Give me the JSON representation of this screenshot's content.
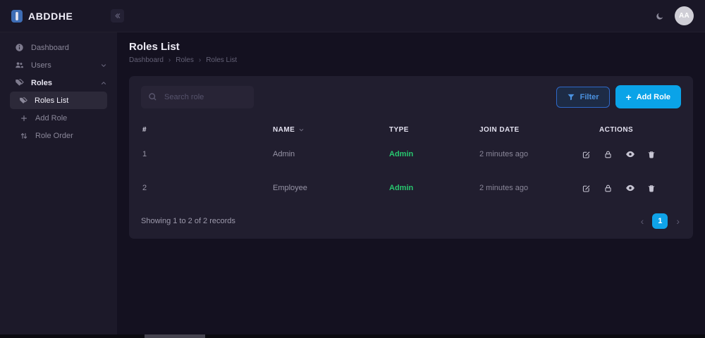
{
  "topbar": {
    "brand": "ABDDHE",
    "avatar_initials": "AA"
  },
  "sidebar": {
    "items": [
      {
        "label": "Dashboard",
        "icon": "dashboard-icon"
      },
      {
        "label": "Users",
        "icon": "users-icon"
      },
      {
        "label": "Roles",
        "icon": "roles-icon"
      },
      {
        "label": "Roles List",
        "icon": "roles-list-icon",
        "active": true
      },
      {
        "label": "Add Role",
        "icon": "plus-icon"
      },
      {
        "label": "Role Order",
        "icon": "sort-order-icon"
      }
    ]
  },
  "page": {
    "title": "Roles List",
    "breadcrumb": [
      "Dashboard",
      "Roles",
      "Roles List"
    ],
    "separator": "›"
  },
  "toolbar": {
    "search_placeholder": "Search role",
    "filter_label": "Filter",
    "add_role_label": "Add Role",
    "plus": "+"
  },
  "table": {
    "columns": [
      "#",
      "NAME",
      "TYPE",
      "JOIN DATE",
      "ACTIONS"
    ],
    "rows": [
      {
        "num": "1",
        "name": "Admin",
        "type": "Admin",
        "join_date": "2 minutes ago"
      },
      {
        "num": "2",
        "name": "Employee",
        "type": "Admin",
        "join_date": "2 minutes ago"
      }
    ],
    "row_actions": [
      "edit",
      "lock",
      "view",
      "delete"
    ]
  },
  "footer": {
    "summary": "Showing 1 to 2 of 2 records",
    "prev": "‹",
    "next": "›",
    "current_page": "1"
  },
  "colors": {
    "accent_blue": "#0aa3e8",
    "filter_border_blue": "#2e68c8",
    "filter_text_blue": "#4b92e0",
    "success_green": "#28c76f",
    "sidebar_bg": "#1c1929",
    "card_bg": "#211e2f",
    "page_bg": "#141120"
  }
}
